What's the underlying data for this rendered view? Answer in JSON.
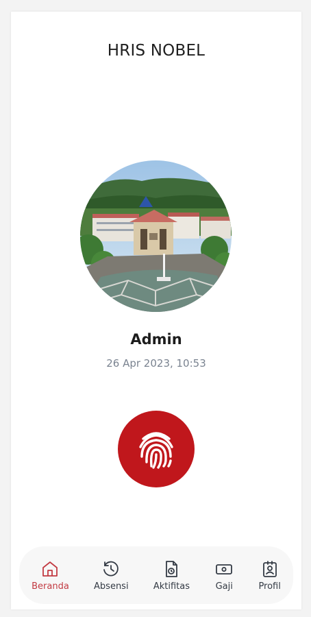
{
  "app": {
    "title": "HRIS NOBEL"
  },
  "profile": {
    "name": "Admin",
    "datetime": "26 Apr 2023, 10:53",
    "photo_icon": "campus-building-photo"
  },
  "attendance": {
    "icon": "fingerprint-icon"
  },
  "colors": {
    "accent": "#c0171c",
    "active_nav": "#c23a42",
    "muted_text": "#7a8390"
  },
  "nav": {
    "items": [
      {
        "label": "Beranda",
        "icon": "home-icon",
        "active": true
      },
      {
        "label": "Absensi",
        "icon": "history-icon",
        "active": false
      },
      {
        "label": "Aktifitas",
        "icon": "activity-icon",
        "active": false
      },
      {
        "label": "Gaji",
        "icon": "money-icon",
        "active": false
      },
      {
        "label": "Profil",
        "icon": "profile-icon",
        "active": false
      }
    ]
  }
}
